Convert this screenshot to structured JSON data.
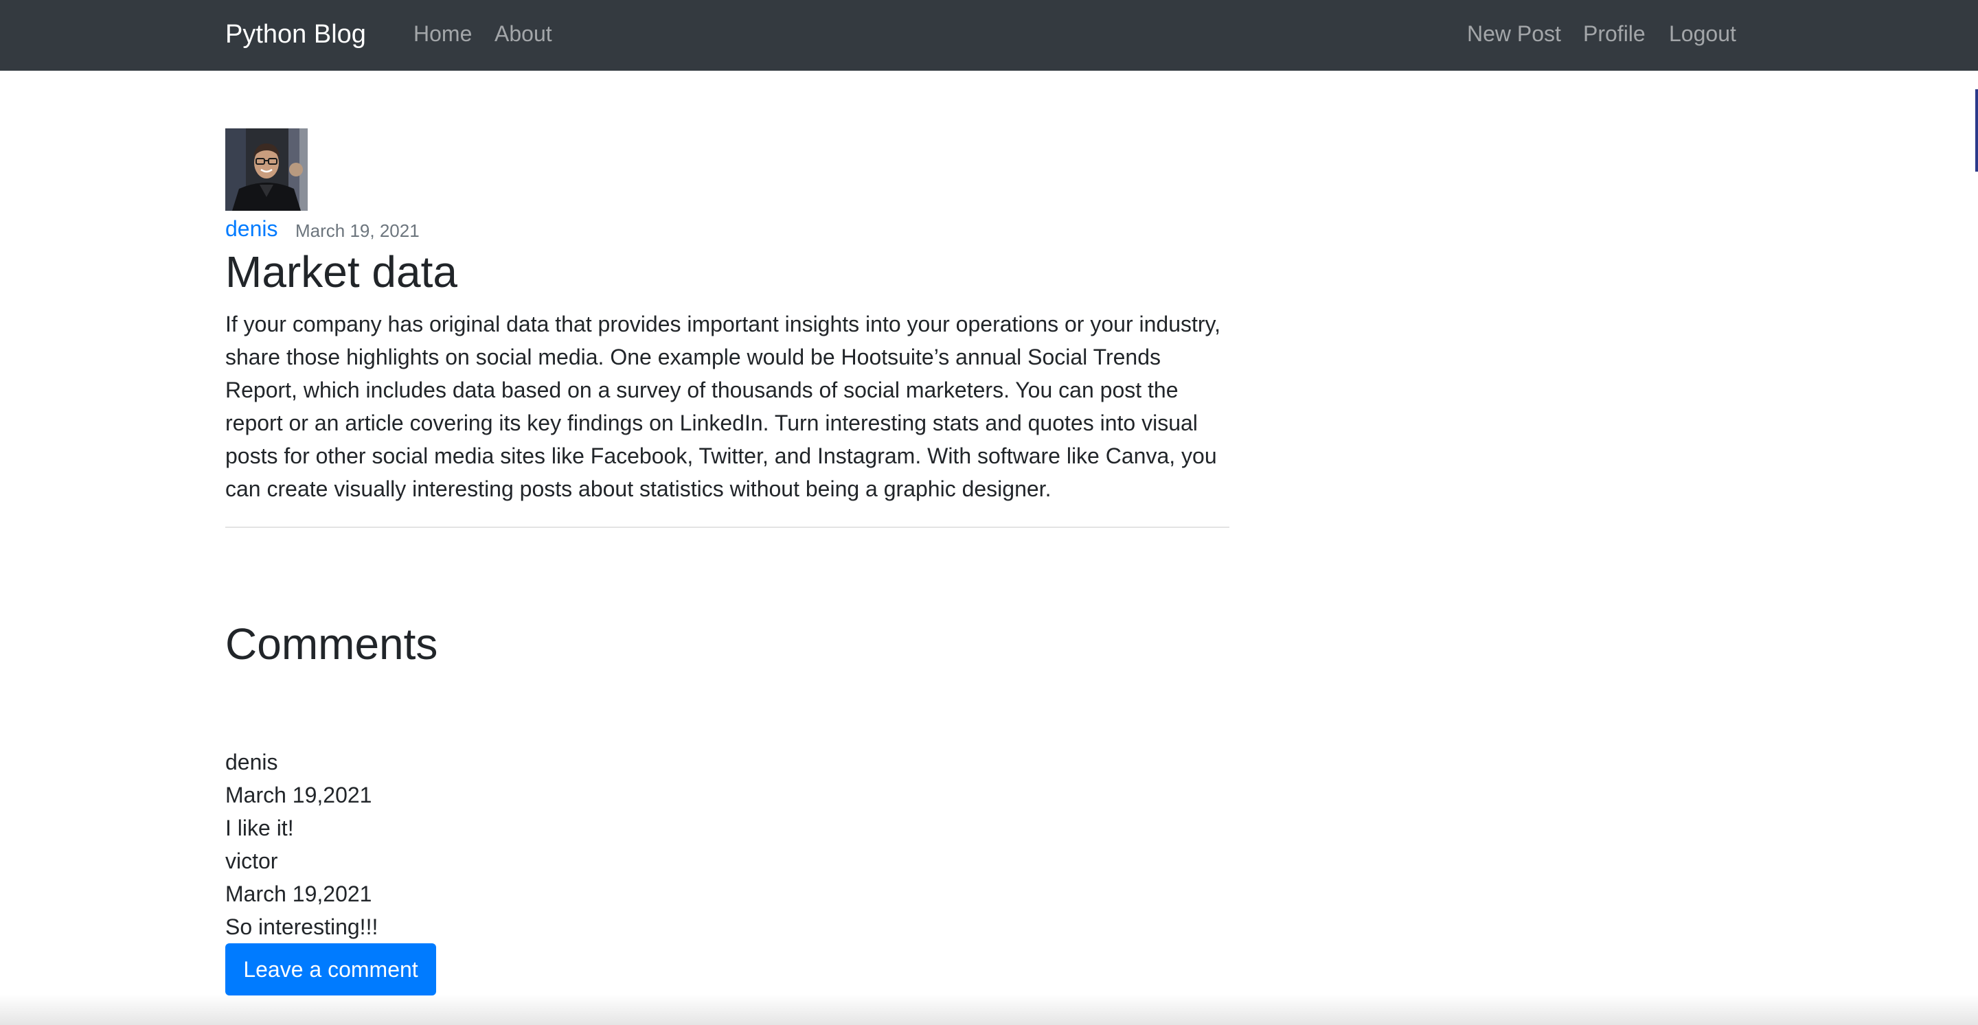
{
  "navbar": {
    "brand": "Python Blog",
    "left_links": [
      "Home",
      "About"
    ],
    "right_links": [
      "New Post",
      "Profile",
      "Logout"
    ],
    "background_color": "#343a40"
  },
  "post": {
    "author": "denis",
    "date": "March 19, 2021",
    "title": "Market data",
    "content": "If your company has original data that provides important insights into your operations or your industry, share those highlights on social media. One example would be Hootsuite’s annual Social Trends Report, which includes data based on a survey of thousands of social marketers. You can post the report or an article covering its key findings on LinkedIn. Turn interesting stats and quotes into visual posts for other social media sites like Facebook, Twitter, and Instagram. With software like Canva, you can create visually interesting posts about statistics without being a graphic designer.",
    "author_link_color": "#007bff"
  },
  "comments": {
    "heading": "Comments",
    "items": [
      {
        "author": "denis",
        "date": "March 19,2021",
        "text": "I like it!"
      },
      {
        "author": "victor",
        "date": "March 19,2021",
        "text": "So interesting!!!"
      }
    ],
    "button_label": "Leave a comment",
    "button_color": "#007bff"
  }
}
